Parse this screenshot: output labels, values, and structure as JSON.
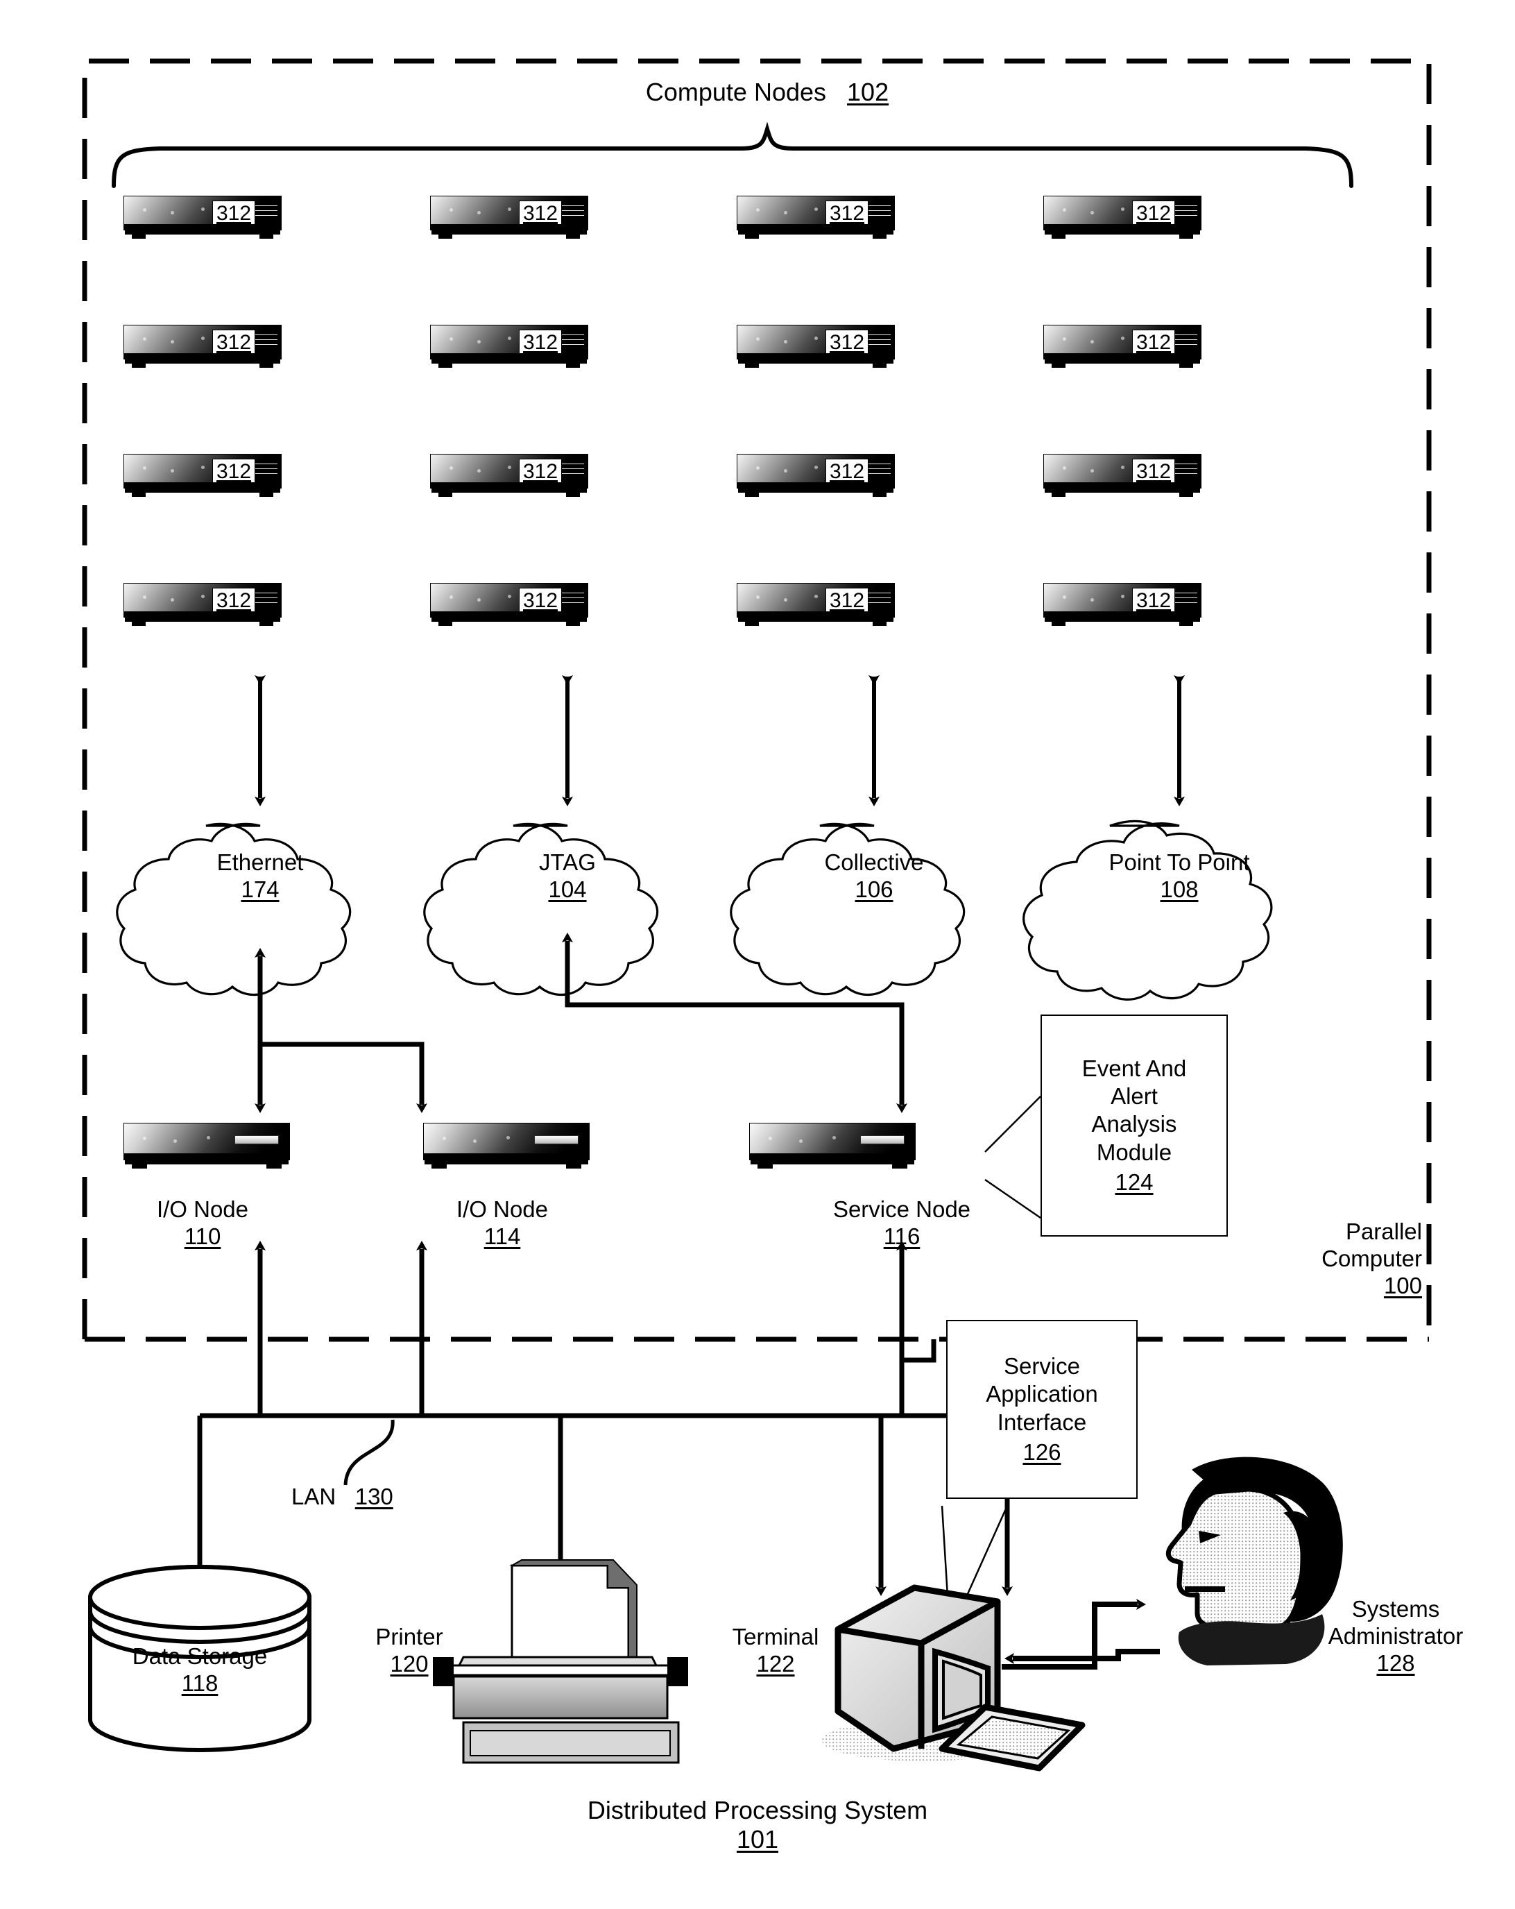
{
  "figure": {
    "top_title": {
      "text": "Compute Nodes",
      "ref": "102"
    },
    "enclosure_label": {
      "line1": "Parallel",
      "line2": "Computer",
      "ref": "100"
    },
    "bottom_caption": {
      "text": "Distributed Processing System",
      "ref": "101"
    }
  },
  "compute_nodes": {
    "rows": 4,
    "cols": 4,
    "ref": "312",
    "labels": [
      [
        "312",
        "312",
        "312",
        "312"
      ],
      [
        "312",
        "312",
        "312",
        "312"
      ],
      [
        "312",
        "312",
        "312",
        "312"
      ],
      [
        "312",
        "312",
        "312",
        "312"
      ]
    ]
  },
  "networks": [
    {
      "name": "Ethernet",
      "ref": "174"
    },
    {
      "name": "JTAG",
      "ref": "104"
    },
    {
      "name": "Collective",
      "ref": "106"
    },
    {
      "name": "Point To Point",
      "ref": "108"
    }
  ],
  "nodes": [
    {
      "name": "I/O Node",
      "ref": "110"
    },
    {
      "name": "I/O Node",
      "ref": "114"
    },
    {
      "name": "Service Node",
      "ref": "116"
    }
  ],
  "modules": {
    "event_alert": {
      "l1": "Event And",
      "l2": "Alert",
      "l3": "Analysis",
      "l4": "Module",
      "ref": "124"
    },
    "service_app": {
      "l1": "Service",
      "l2": "Application",
      "l3": "Interface",
      "ref": "126"
    }
  },
  "lan": {
    "name": "LAN",
    "ref": "130"
  },
  "peripherals": [
    {
      "name": "Data Storage",
      "ref": "118"
    },
    {
      "name": "Printer",
      "ref": "120"
    },
    {
      "name": "Terminal",
      "ref": "122"
    }
  ],
  "actor": {
    "l1": "Systems",
    "l2": "Administrator",
    "ref": "128"
  },
  "colors": {
    "ink": "#000000",
    "paper": "#ffffff"
  }
}
